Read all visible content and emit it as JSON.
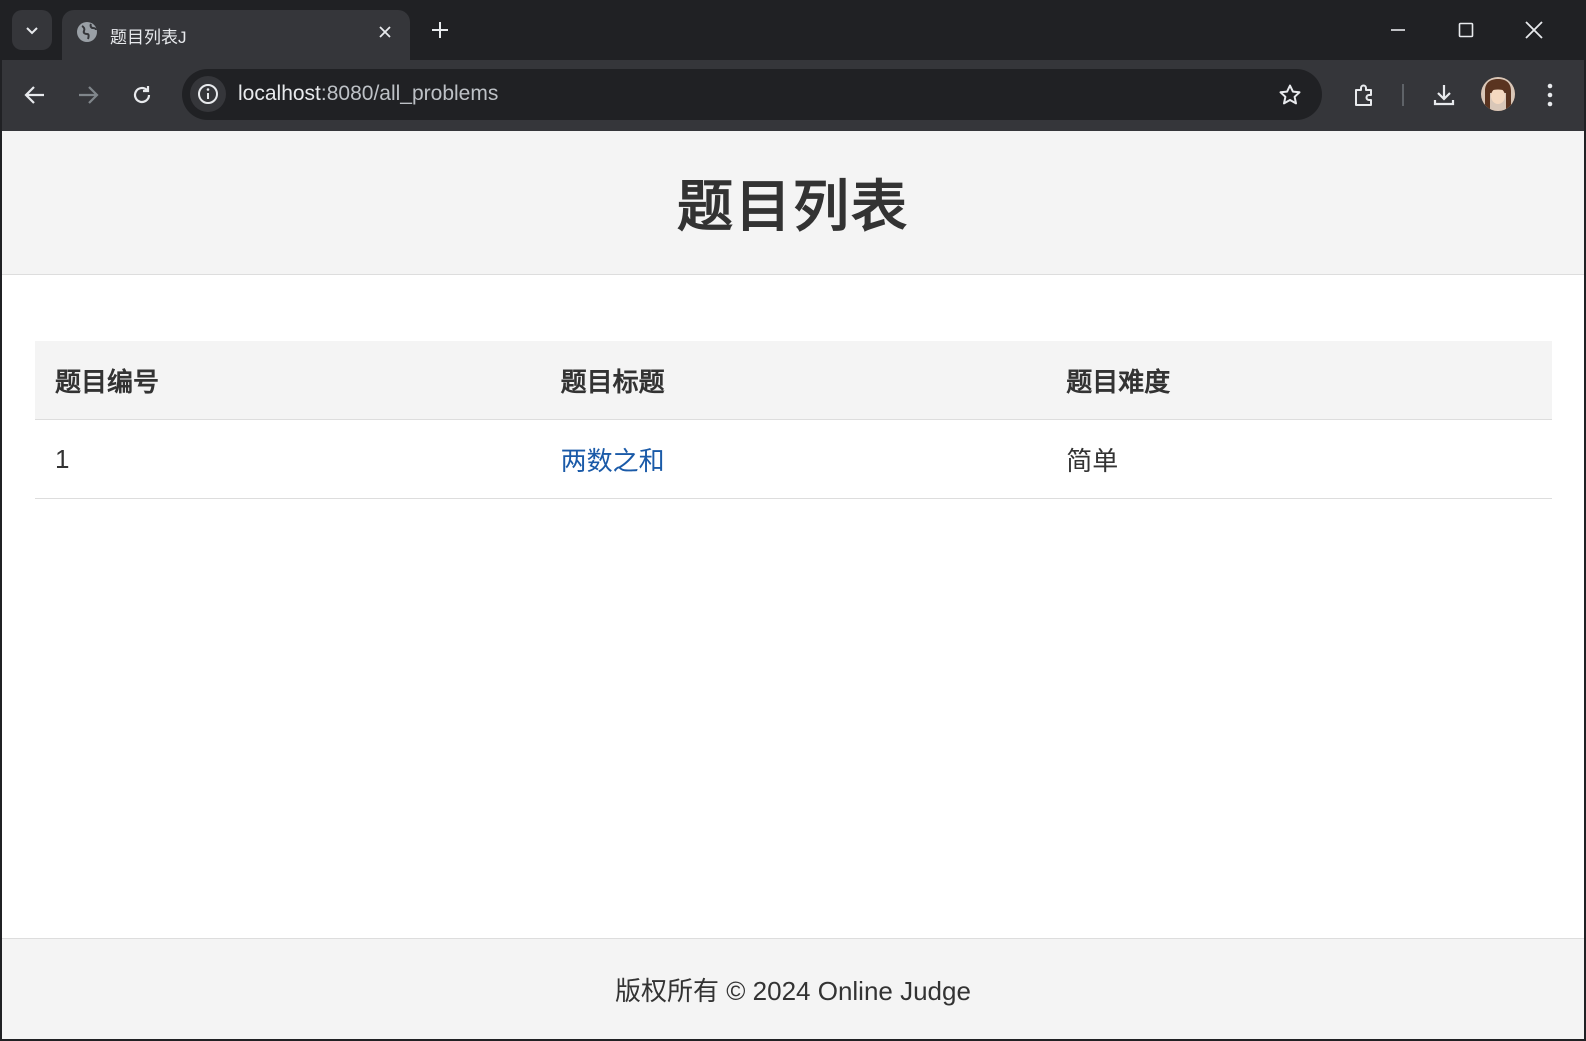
{
  "browser": {
    "tab": {
      "title": "题目列表J",
      "favicon": "globe-icon"
    },
    "url": {
      "host": "localhost",
      "path": ":8080/all_problems"
    },
    "icons": {
      "tab_search": "chevron-down-icon",
      "tab_close": "close-icon",
      "new_tab": "plus-icon",
      "minimize": "minimize-icon",
      "maximize": "maximize-icon",
      "close_window": "close-icon",
      "back": "arrow-left-icon",
      "forward": "arrow-right-icon",
      "reload": "reload-icon",
      "site_info": "info-icon",
      "bookmark": "star-icon",
      "extensions": "puzzle-icon",
      "downloads": "download-icon",
      "profile": "avatar",
      "menu": "kebab-menu-icon"
    }
  },
  "page": {
    "title": "题目列表",
    "table": {
      "headers": [
        "题目编号",
        "题目标题",
        "题目难度"
      ],
      "rows": [
        {
          "id": "1",
          "title": "两数之和",
          "difficulty": "简单"
        }
      ]
    },
    "footer": "版权所有 © 2024 Online Judge"
  },
  "colors": {
    "chrome_dark": "#202124",
    "chrome_toolbar": "#35363a",
    "page_header_bg": "#f4f4f4",
    "link": "#1a5aa8",
    "text": "#333333"
  }
}
